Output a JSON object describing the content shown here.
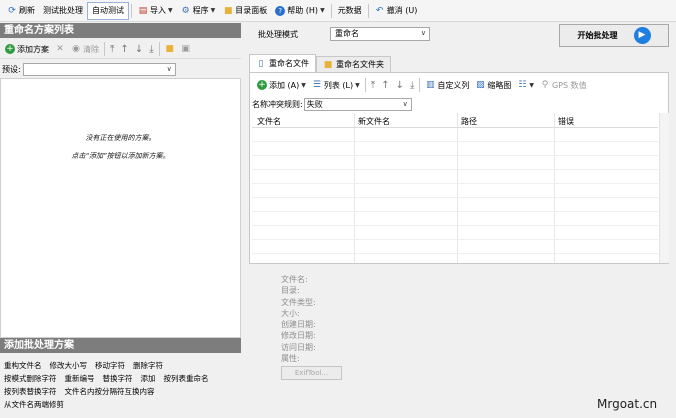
{
  "toolbar": {
    "refresh": "刷新",
    "test_batch": "测试批处理",
    "auto_test": "自动测试",
    "import": "导入",
    "program": "程序",
    "dir_panel": "目录面板",
    "help": "帮助 (H)",
    "metadata": "元数据",
    "undo": "撤消 (U)"
  },
  "left": {
    "scheme_list_title": "重命名方案列表",
    "add_scheme": "添加方案",
    "clear": "清除",
    "preset_label": "预设:",
    "preset_value": "",
    "hint1": "没有正在使用的方案。",
    "hint2": "点击“添加”按钮以添加新方案。",
    "batch_title": "添加批处理方案",
    "ops": [
      [
        "重构文件名",
        "修改大小写",
        "移动字符",
        "删除字符"
      ],
      [
        "按模式删除字符",
        "重新编号",
        "替换字符",
        "添加",
        "按列表重命名"
      ],
      [
        "按列表替换字符",
        "文件名内按分隔符互换内容"
      ],
      [
        "从文件名两端修剪"
      ]
    ]
  },
  "right": {
    "mode_label": "批处理模式",
    "mode_value": "重命名",
    "start_button": "开始批处理",
    "tabs": [
      "重命名文件",
      "重命名文件夹"
    ],
    "add": "添加 (A)",
    "list": "列表 (L)",
    "custom_columns": "自定义列",
    "thumbnail": "缩略图",
    "gps": "GPS 数值",
    "conflict_label": "名称冲突规则:",
    "conflict_value": "失败",
    "columns": [
      "文件名",
      "新文件名",
      "路径",
      "错误"
    ],
    "info": [
      "文件名:",
      "目录:",
      "文件类型:",
      "大小:",
      "创建日期:",
      "修改日期:",
      "访问日期:",
      "属性:"
    ],
    "exif_button": "ExifTool..."
  },
  "watermark": "Mrgoat.cn",
  "colors": {
    "panel_header": "#7d7d7d",
    "start_icon": "#1e7fe0",
    "add_green": "#2e9a3e",
    "folder": "#e8b13a"
  }
}
